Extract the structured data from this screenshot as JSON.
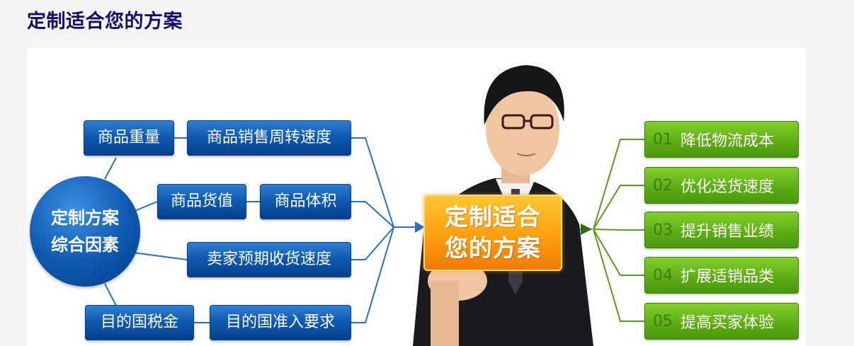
{
  "page": {
    "title": "定制适合您的方案"
  },
  "factors": {
    "center": {
      "line1": "定制方案",
      "line2": "综合因素"
    },
    "items": [
      "商品重量",
      "商品销售周转速度",
      "商品货值",
      "商品体积",
      "卖家预期收货速度",
      "目的国税金",
      "目的国准入要求"
    ]
  },
  "plan": {
    "line1": "定制适合",
    "line2": "您的方案"
  },
  "benefits": [
    {
      "num": "01",
      "label": "降低物流成本"
    },
    {
      "num": "02",
      "label": "优化送货速度"
    },
    {
      "num": "03",
      "label": "提升销售业绩"
    },
    {
      "num": "04",
      "label": "扩展适销品类"
    },
    {
      "num": "05",
      "label": "提高买家体验"
    }
  ],
  "colors": {
    "title": "#10106b",
    "blue": "#0f5bb3",
    "orange": "#ff9f10",
    "green": "#5fae16"
  }
}
